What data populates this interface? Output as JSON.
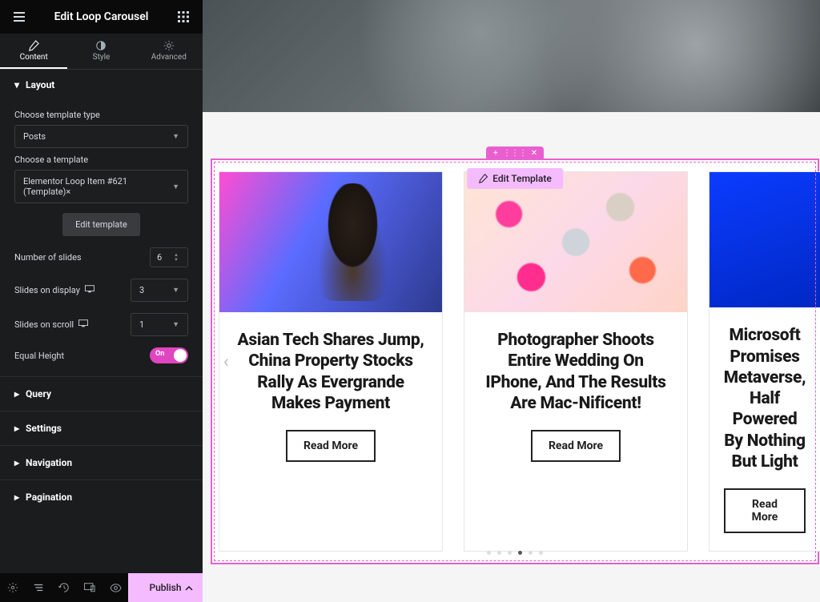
{
  "header": {
    "title": "Edit Loop Carousel"
  },
  "tabs": {
    "content": "Content",
    "style": "Style",
    "advanced": "Advanced"
  },
  "layout": {
    "section_label": "Layout",
    "template_type_label": "Choose template type",
    "template_type_value": "Posts",
    "template_label": "Choose a template",
    "template_value": "Elementor Loop Item #621 (Template)×",
    "edit_template_btn": "Edit template",
    "num_slides_label": "Number of slides",
    "num_slides_value": "6",
    "slides_display_label": "Slides on display",
    "slides_display_value": "3",
    "slides_scroll_label": "Slides on scroll",
    "slides_scroll_value": "1",
    "equal_height_label": "Equal Height",
    "equal_height_value": "On"
  },
  "sections": {
    "query": "Query",
    "settings": "Settings",
    "navigation": "Navigation",
    "pagination": "Pagination"
  },
  "footer": {
    "publish": "Publish"
  },
  "preview": {
    "edit_template_pill": "Edit Template",
    "cards": [
      {
        "title": "Asian Tech Shares Jump, China Property Stocks Rally As Evergrande Makes Payment",
        "cta": "Read More"
      },
      {
        "title": "Photographer Shoots Entire Wedding On IPhone, And The Results Are Mac-Nificent!",
        "cta": "Read More"
      },
      {
        "title": "Microsoft Promises Metaverse, Half Powered By Nothing But Light",
        "cta": "Read More"
      }
    ],
    "dots_total": 6,
    "dots_active_index": 3
  }
}
